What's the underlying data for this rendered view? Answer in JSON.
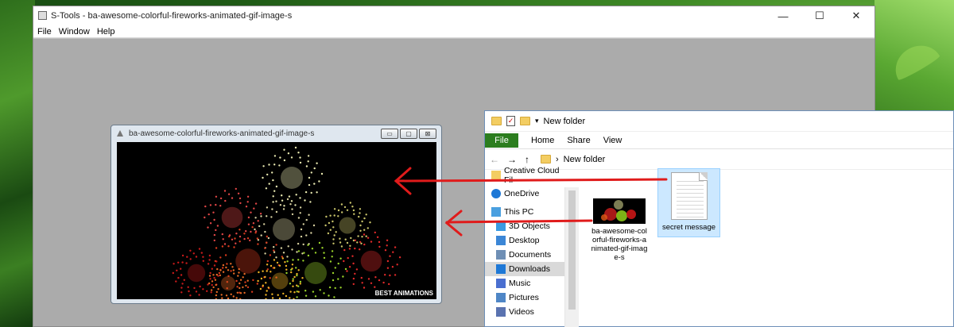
{
  "stools": {
    "title": "S-Tools - ba-awesome-colorful-fireworks-animated-gif-image-s",
    "menu": [
      "File",
      "Window",
      "Help"
    ],
    "controls": {
      "minimize": "—",
      "maximize": "☐",
      "close": "✕"
    }
  },
  "image_window": {
    "title": "ba-awesome-colorful-fireworks-animated-gif-image-s",
    "watermark": "BEST ANIMATIONS",
    "controls": {
      "minimize": "▭",
      "maximize": "▢",
      "close": "⊠"
    }
  },
  "explorer": {
    "title": "New folder",
    "ribbon_tabs": [
      "File",
      "Home",
      "Share",
      "View"
    ],
    "address": "New folder",
    "nav_glyphs": {
      "back": "←",
      "forward": "→",
      "up": "↑",
      "separator": "›"
    },
    "nav_items": [
      {
        "label": "Creative Cloud Fil",
        "icon": "creative-cloud-folder-icon"
      },
      {
        "label": "OneDrive",
        "icon": "onedrive-cloud-icon"
      },
      {
        "label": "This PC",
        "icon": "computer-icon"
      },
      {
        "label": "3D Objects",
        "icon": "cube-icon"
      },
      {
        "label": "Desktop",
        "icon": "desktop-icon"
      },
      {
        "label": "Documents",
        "icon": "documents-icon"
      },
      {
        "label": "Downloads",
        "icon": "download-arrow-icon",
        "selected": true
      },
      {
        "label": "Music",
        "icon": "music-note-icon"
      },
      {
        "label": "Pictures",
        "icon": "pictures-icon"
      },
      {
        "label": "Videos",
        "icon": "videos-icon"
      }
    ],
    "files": [
      {
        "name": "ba-awesome-colorful-fireworks-animated-gif-image-s",
        "type": "image"
      },
      {
        "name": "secret message",
        "type": "text-document",
        "selected": true
      }
    ]
  },
  "colors": {
    "annotation_arrow": "#e01b1b",
    "ribbon_file_tab": "#2b7d1e",
    "selection": "#cce8ff"
  }
}
